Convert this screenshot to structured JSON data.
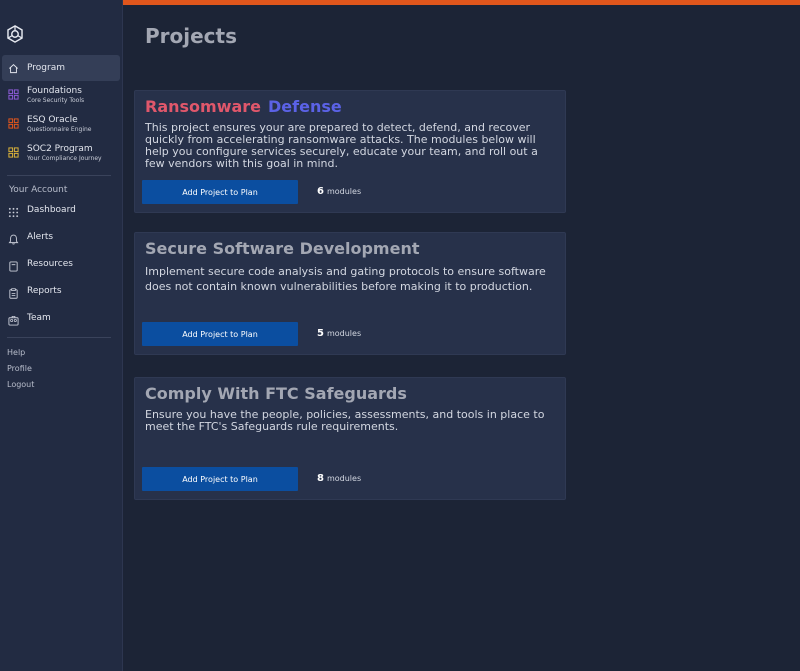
{
  "sidebar": {
    "primary": [
      {
        "label": "Program",
        "sub": "",
        "icon": "home-icon"
      },
      {
        "label": "Foundations",
        "sub": "Core Security Tools",
        "icon": "grid-icon"
      },
      {
        "label": "ESQ Oracle",
        "sub": "Questionnaire Engine",
        "icon": "grid-icon"
      },
      {
        "label": "SOC2 Program",
        "sub": "Your Compliance Journey",
        "icon": "grid-icon"
      }
    ],
    "section_label": "Your Account",
    "account": [
      {
        "label": "Dashboard",
        "icon": "dots-grid-icon"
      },
      {
        "label": "Alerts",
        "icon": "bell-icon"
      },
      {
        "label": "Resources",
        "icon": "book-icon"
      },
      {
        "label": "Reports",
        "icon": "clipboard-icon"
      },
      {
        "label": "Team",
        "icon": "team-icon"
      }
    ],
    "footer": [
      "Help",
      "Profile",
      "Logout"
    ]
  },
  "colors": {
    "accent_bar": "#e0561c",
    "foundations_icon": "#8b5bd6",
    "oracle_icon": "#e0561c",
    "soc2_icon": "#d9b13a",
    "button": "#0b4ea0",
    "title_ransomware": "#e0576b",
    "title_defense": "#5b62e6"
  },
  "page": {
    "title": "Projects"
  },
  "projects": [
    {
      "title_part1": "Ransomware",
      "title_part2": "Defense",
      "description": "This project ensures your are prepared to detect, defend, and recover quickly from accelerating ransomware attacks. The modules below will help you configure services securely, educate your team, and roll out a few vendors with this goal in mind.",
      "button_label": "Add Project to Plan",
      "module_count": "6",
      "module_label": "modules"
    },
    {
      "title": "Secure Software Development",
      "description": "Implement secure code analysis and gating protocols to ensure software does not contain known vulnerabilities before making it to production.",
      "button_label": "Add Project to Plan",
      "module_count": "5",
      "module_label": "modules"
    },
    {
      "title": "Comply With FTC Safeguards",
      "description": "Ensure you have the people, policies, assessments, and tools in place to meet the FTC's Safeguards rule requirements.",
      "button_label": "Add Project to Plan",
      "module_count": "8",
      "module_label": "modules"
    }
  ]
}
